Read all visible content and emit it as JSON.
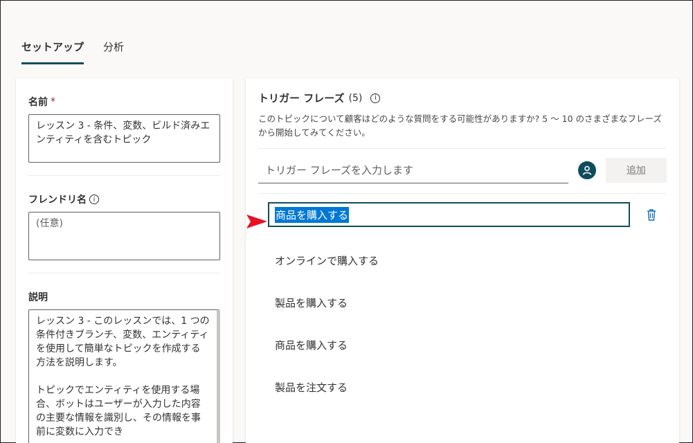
{
  "tabs": [
    {
      "label": "セットアップ",
      "active": true
    },
    {
      "label": "分析",
      "active": false
    }
  ],
  "left": {
    "name_label": "名前",
    "required_mark": "*",
    "name_value": "レッスン 3 - 条件、変数、ビルド済みエンティティを含むトピック",
    "friendly_label": "フレンドリ名",
    "friendly_placeholder": "(任意)",
    "desc_label": "説明",
    "desc_para1": "レッスン 3 - このレッスンでは、1 つの条件付きブランチ、変数、エンティティを使用して簡単なトピックを作成する方法を説明します。",
    "desc_para2": "トピックでエンティティを使用する場合、ボットはユーザーが入力した内容の主要な情報を識別し、その情報を事前に変数に入力でき"
  },
  "right": {
    "title": "トリガー フレーズ",
    "count": "(5)",
    "description": "このトピックについて顧客はどのような質問をする可能性がありますか? 5 〜 10 のさまざまなフレーズから開始してみてください。",
    "input_placeholder": "トリガー フレーズを入力します",
    "add_label": "追加",
    "selected_phrase": "商品を購入する",
    "phrases": [
      "オンラインで購入する",
      "製品を購入する",
      "商品を購入する",
      "製品を注文する"
    ]
  },
  "colors": {
    "accent": "#0f4c5c",
    "selection": "#0078d4",
    "arrow": "#e81123"
  },
  "icons": [
    "info-icon",
    "user-avatar-icon",
    "trash-icon",
    "pointer-arrow-icon"
  ]
}
